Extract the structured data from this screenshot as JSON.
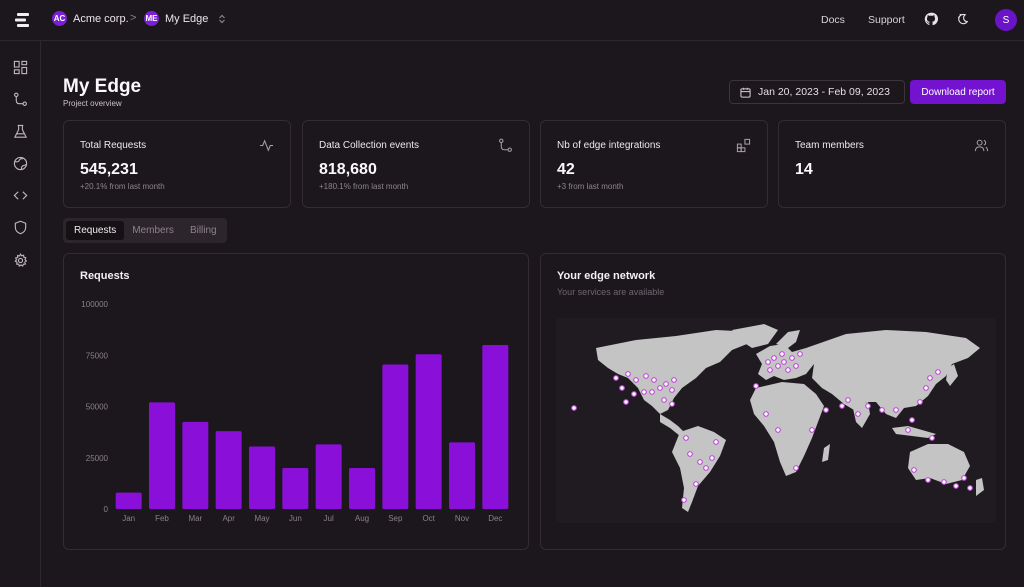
{
  "topbar": {
    "org": {
      "badge": "AC",
      "name": "Acme corp."
    },
    "separator": ">",
    "project": {
      "badge": "ME",
      "name": "My Edge"
    },
    "links": {
      "docs": "Docs",
      "support": "Support"
    },
    "avatar_initial": "S",
    "icons": [
      "logo-icon",
      "github-icon",
      "theme-toggle-icon"
    ]
  },
  "sidebar": {
    "items": [
      {
        "name": "dashboard-icon"
      },
      {
        "name": "git-branch-icon"
      },
      {
        "name": "flask-icon"
      },
      {
        "name": "globe-icon"
      },
      {
        "name": "code-icon"
      },
      {
        "name": "shield-icon"
      },
      {
        "name": "gear-icon"
      }
    ]
  },
  "header": {
    "title": "My Edge",
    "subtitle": "Project overview",
    "date_range": "Jan 20, 2023 - Feb 09, 2023",
    "download_label": "Download report"
  },
  "stats": [
    {
      "title": "Total Requests",
      "value": "545,231",
      "delta": "+20.1% from last month",
      "icon": "activity-icon"
    },
    {
      "title": "Data Collection events",
      "value": "818,680",
      "delta": "+180.1% from last month",
      "icon": "git-branch-icon"
    },
    {
      "title": "Nb of edge integrations",
      "value": "42",
      "delta": "+3 from last month",
      "icon": "blocks-icon"
    },
    {
      "title": "Team members",
      "value": "14",
      "delta": "",
      "icon": "users-icon"
    }
  ],
  "tabs": [
    {
      "label": "Requests",
      "active": true
    },
    {
      "label": "Members",
      "active": false
    },
    {
      "label": "Billing",
      "active": false
    }
  ],
  "requests_card": {
    "title": "Requests"
  },
  "network_card": {
    "title": "Your edge network",
    "subtitle": "Your services are available"
  },
  "colors": {
    "accent": "#7313cf",
    "bar": "#8a0fd8",
    "background": "#1c171c",
    "map_land": "#c4c4c4",
    "map_dot": "#c04bd8"
  },
  "chart_data": {
    "type": "bar",
    "title": "Requests",
    "categories": [
      "Jan",
      "Feb",
      "Mar",
      "Apr",
      "May",
      "Jun",
      "Jul",
      "Aug",
      "Sep",
      "Oct",
      "Nov",
      "Dec"
    ],
    "values": [
      8000,
      52000,
      42500,
      38000,
      30500,
      20000,
      31500,
      20000,
      70500,
      75500,
      32500,
      80000
    ],
    "yticks": [
      "0",
      "25000",
      "50000",
      "75000",
      "100000"
    ],
    "ylim": [
      0,
      100000
    ],
    "xlabel": "",
    "ylabel": "",
    "grid": false
  }
}
